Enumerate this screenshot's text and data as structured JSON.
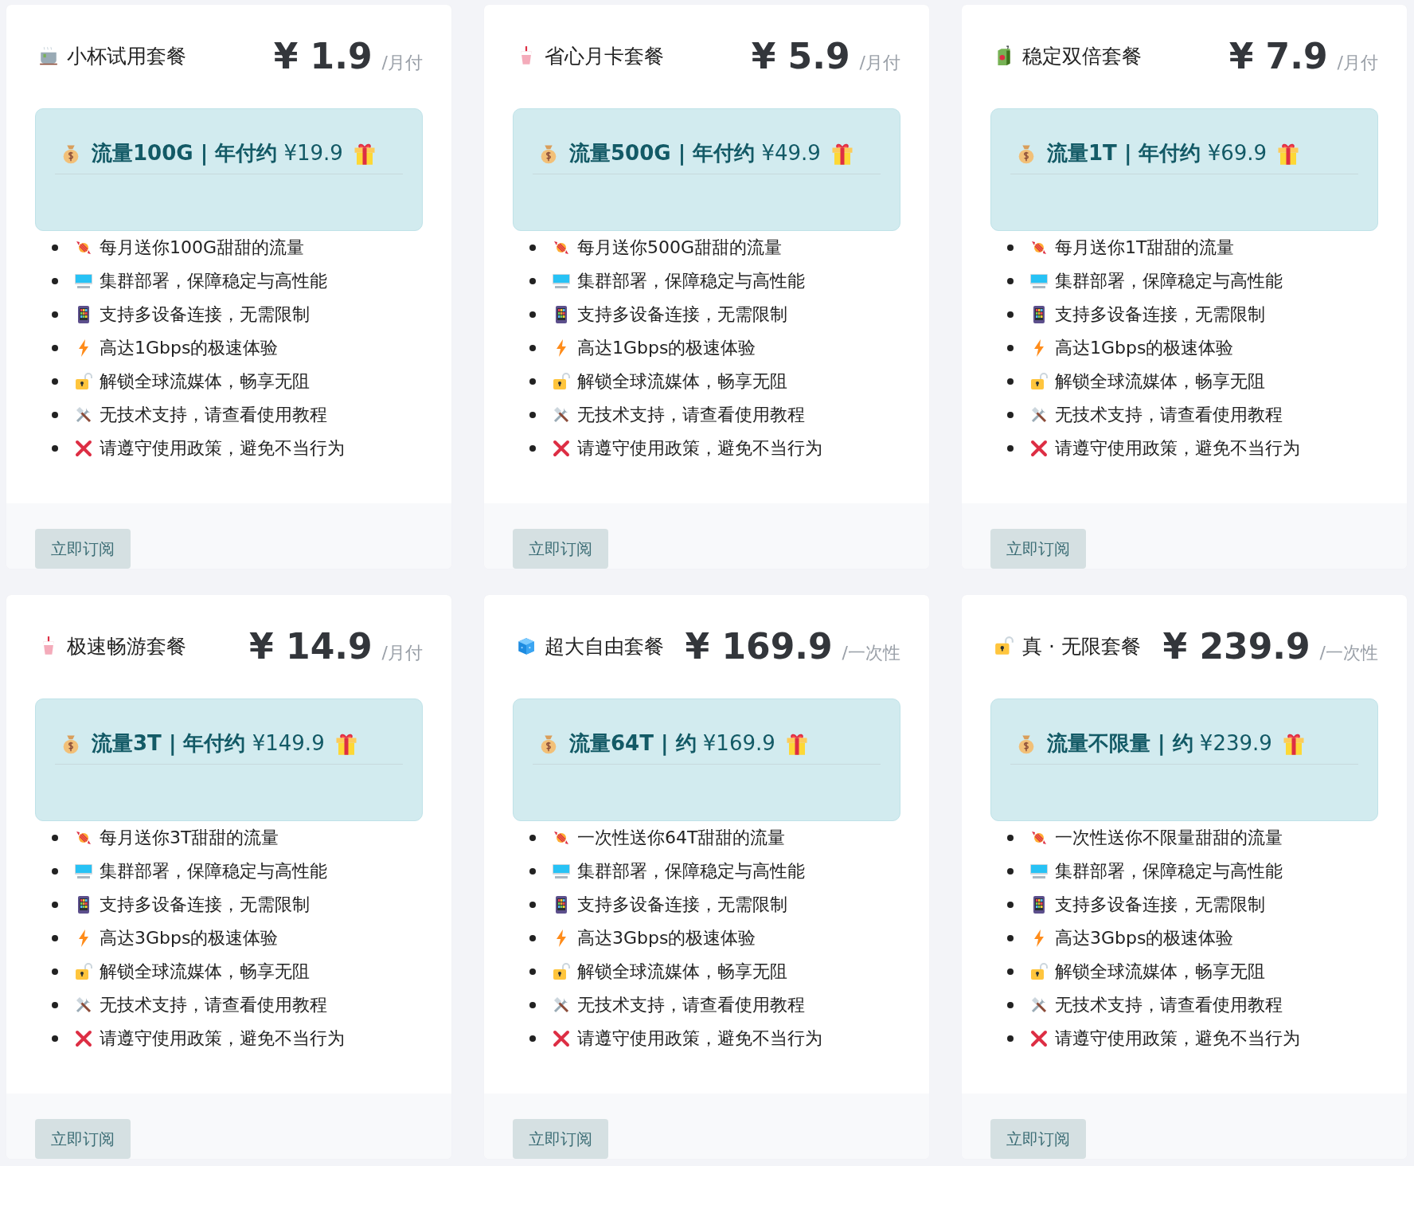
{
  "plans": [
    {
      "title": "小杯试用套餐",
      "price": "¥ 1.9",
      "period": "/月付",
      "highlight": "**流量100G | 年付约** ¥19.9",
      "features": [
        "每月送你100G甜甜的流量",
        "集群部署，保障稳定与高性能",
        "支持多设备连接，无需限制",
        "高达1Gbps的极速体验",
        "解锁全球流媒体，畅享无阻",
        "无技术支持，请查看使用教程",
        "请遵守使用政策，避免不当行为"
      ],
      "button": "立即订阅"
    },
    {
      "title": "省心月卡套餐",
      "price": "¥ 5.9",
      "period": "/月付",
      "highlight": "**流量500G | 年付约** ¥49.9",
      "features": [
        "每月送你500G甜甜的流量",
        "集群部署，保障稳定与高性能",
        "支持多设备连接，无需限制",
        "高达1Gbps的极速体验",
        "解锁全球流媒体，畅享无阻",
        "无技术支持，请查看使用教程",
        "请遵守使用政策，避免不当行为"
      ],
      "button": "立即订阅"
    },
    {
      "title": "稳定双倍套餐",
      "price": "¥ 7.9",
      "period": "/月付",
      "highlight": "**流量1T | 年付约** ¥69.9",
      "features": [
        "每月送你1T甜甜的流量",
        "集群部署，保障稳定与高性能",
        "支持多设备连接，无需限制",
        "高达1Gbps的极速体验",
        "解锁全球流媒体，畅享无阻",
        "无技术支持，请查看使用教程",
        "请遵守使用政策，避免不当行为"
      ],
      "button": "立即订阅"
    },
    {
      "title": "极速畅游套餐",
      "price": "¥ 14.9",
      "period": "/月付",
      "highlight": "**流量3T | 年付约** ¥149.9",
      "features": [
        "每月送你3T甜甜的流量",
        "集群部署，保障稳定与高性能",
        "支持多设备连接，无需限制",
        "高达3Gbps的极速体验",
        "解锁全球流媒体，畅享无阻",
        "无技术支持，请查看使用教程",
        "请遵守使用政策，避免不当行为"
      ],
      "button": "立即订阅"
    },
    {
      "title": "超大自由套餐",
      "price": "¥ 169.9",
      "period": "/一次性",
      "highlight": "**流量64T | 约** ¥169.9",
      "features": [
        "一次性送你64T甜甜的流量",
        "集群部署，保障稳定与高性能",
        "支持多设备连接，无需限制",
        "高达3Gbps的极速体验",
        "解锁全球流媒体，畅享无阻",
        "无技术支持，请查看使用教程",
        "请遵守使用政策，避免不当行为"
      ],
      "button": "立即订阅"
    },
    {
      "title": "真 · 无限套餐",
      "price": "¥ 239.9",
      "period": "/一次性",
      "highlight": "**流量不限量 | 约** ¥239.9",
      "features": [
        "一次性送你不限量甜甜的流量",
        "集群部署，保障稳定与高性能",
        "支持多设备连接，无需限制",
        "高达3Gbps的极速体验",
        "解锁全球流媒体，畅享无阻",
        "无技术支持，请查看使用教程",
        "请遵守使用政策，避免不当行为"
      ],
      "button": "立即订阅"
    }
  ]
}
